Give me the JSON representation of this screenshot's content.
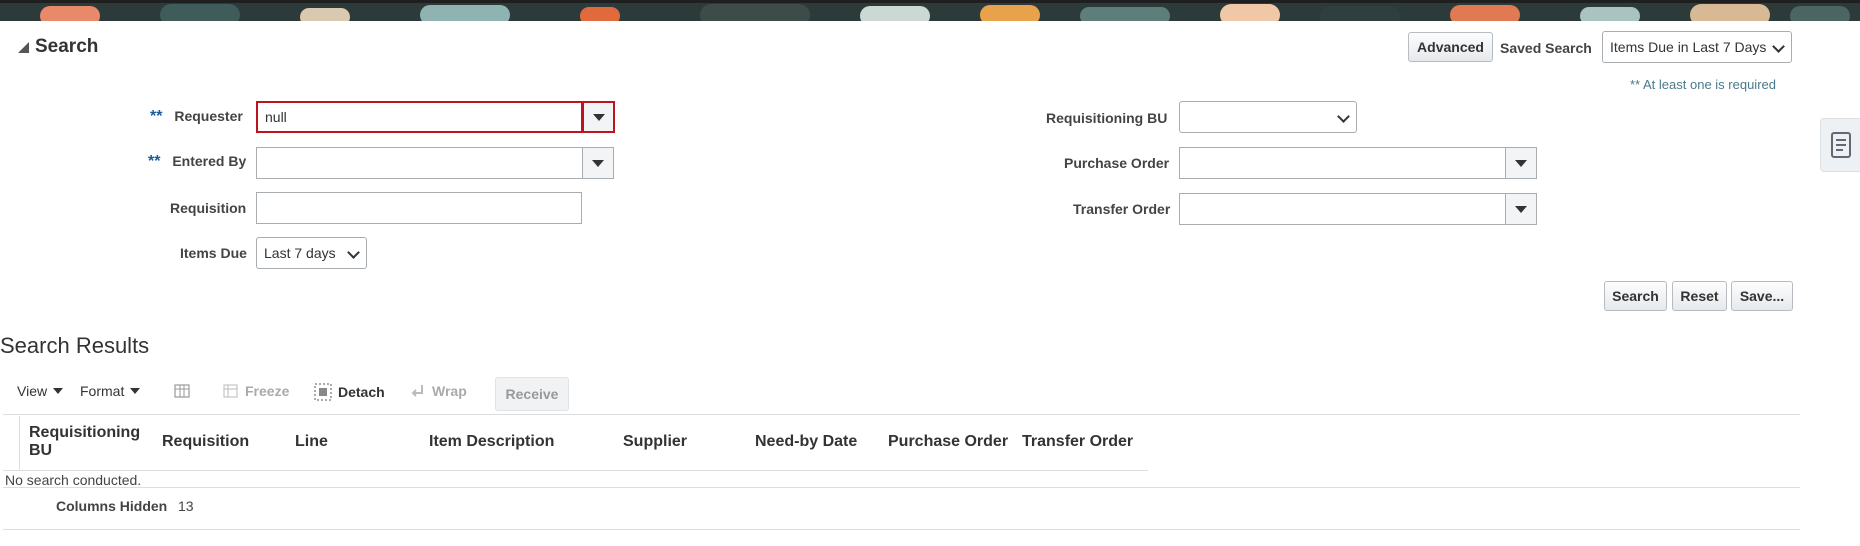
{
  "search": {
    "title": "Search",
    "advanced_label": "Advanced",
    "saved_search_label": "Saved Search",
    "saved_search_value": "Items Due in Last 7 Days",
    "required_note": "** At least one is required",
    "required_marker": "**",
    "fields": {
      "requester": {
        "label": "Requester",
        "value": "null"
      },
      "entered_by": {
        "label": "Entered By",
        "value": ""
      },
      "requisition": {
        "label": "Requisition",
        "value": ""
      },
      "items_due": {
        "label": "Items Due",
        "value": "Last 7 days"
      },
      "requisitioning_bu": {
        "label": "Requisitioning BU",
        "value": ""
      },
      "purchase_order": {
        "label": "Purchase Order",
        "value": ""
      },
      "transfer_order": {
        "label": "Transfer Order",
        "value": ""
      }
    },
    "buttons": {
      "search": "Search",
      "reset": "Reset",
      "save": "Save..."
    }
  },
  "results": {
    "title": "Search Results",
    "toolbar": {
      "view": "View",
      "format": "Format",
      "freeze": "Freeze",
      "detach": "Detach",
      "wrap": "Wrap",
      "receive": "Receive"
    },
    "columns": [
      "Requisitioning BU",
      "Requisition",
      "Line",
      "Item Description",
      "Supplier",
      "Need-by Date",
      "Purchase Order",
      "Transfer Order"
    ],
    "empty_message": "No search conducted.",
    "columns_hidden_label": "Columns Hidden",
    "columns_hidden_count": "13"
  },
  "colors": {
    "error_border": "#c0131f",
    "required_marker": "#1a5b9a"
  }
}
